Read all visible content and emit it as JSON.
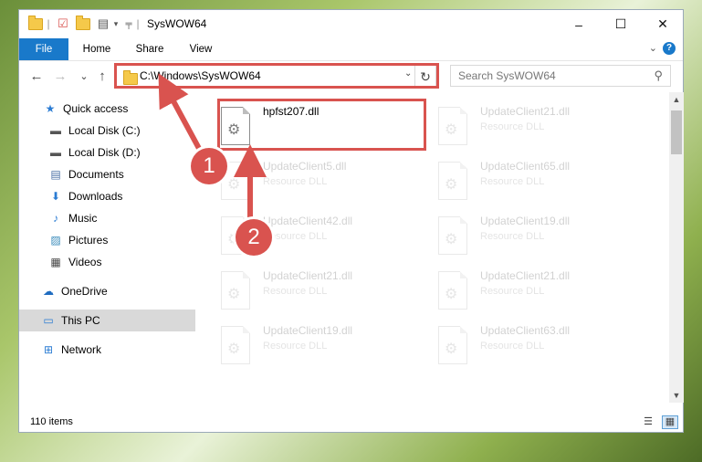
{
  "window": {
    "title": "SysWOW64",
    "controls": {
      "minimize": "–",
      "maximize": "☐",
      "close": "✕"
    }
  },
  "ribbon": {
    "tabs": [
      {
        "label": "File"
      },
      {
        "label": "Home"
      },
      {
        "label": "Share"
      },
      {
        "label": "View"
      }
    ],
    "expand": "⌄",
    "help": "?"
  },
  "navbar": {
    "back": "←",
    "forward": "→",
    "recent": "⌄",
    "up": "↑",
    "address": "C:\\Windows\\SysWOW64",
    "address_dropdown": "⌄",
    "refresh": "↻",
    "search_placeholder": "Search SysWOW64",
    "search_icon": "⚲"
  },
  "sidebar": {
    "items": [
      {
        "label": "Quick access",
        "icon": "star-icon",
        "glyph": "★",
        "color": "#2b7cd3",
        "pinned": false
      },
      {
        "label": "Local Disk (C:)",
        "icon": "drive-icon",
        "glyph": "▬",
        "color": "#555555",
        "pinned": true
      },
      {
        "label": "Local Disk (D:)",
        "icon": "drive-icon",
        "glyph": "▬",
        "color": "#555555",
        "pinned": true
      },
      {
        "label": "Documents",
        "icon": "documents-icon",
        "glyph": "▤",
        "color": "#4a6fa5",
        "pinned": true
      },
      {
        "label": "Downloads",
        "icon": "downloads-icon",
        "glyph": "⬇",
        "color": "#2b7cd3",
        "pinned": true
      },
      {
        "label": "Music",
        "icon": "music-icon",
        "glyph": "♪",
        "color": "#2b7cd3",
        "pinned": true
      },
      {
        "label": "Pictures",
        "icon": "pictures-icon",
        "glyph": "▨",
        "color": "#3c8dbc",
        "pinned": true
      },
      {
        "label": "Videos",
        "icon": "videos-icon",
        "glyph": "▦",
        "color": "#444444",
        "pinned": true
      },
      {
        "label": "OneDrive",
        "icon": "onedrive-icon",
        "glyph": "☁",
        "color": "#1f6cc0",
        "pinned": false
      },
      {
        "label": "This PC",
        "icon": "computer-icon",
        "glyph": "▭",
        "color": "#2b7cd3",
        "pinned": false,
        "selected": true
      },
      {
        "label": "Network",
        "icon": "network-icon",
        "glyph": "⊞",
        "color": "#2b7cd3",
        "pinned": false
      }
    ],
    "pin_glyph": "📌"
  },
  "files": [
    {
      "name": "hpfst207.dll",
      "type": "",
      "faded": false
    },
    {
      "name": "UpdateClient21.dll",
      "type": "Resource DLL",
      "faded": true
    },
    {
      "name": "UpdateClient5.dll",
      "type": "Resource DLL",
      "faded": true
    },
    {
      "name": "UpdateClient65.dll",
      "type": "Resource DLL",
      "faded": true
    },
    {
      "name": "UpdateClient42.dll",
      "type": "Resource DLL",
      "faded": true
    },
    {
      "name": "UpdateClient19.dll",
      "type": "Resource DLL",
      "faded": true
    },
    {
      "name": "UpdateClient21.dll",
      "type": "Resource DLL",
      "faded": true
    },
    {
      "name": "UpdateClient21.dll",
      "type": "Resource DLL",
      "faded": true
    },
    {
      "name": "UpdateClient19.dll",
      "type": "Resource DLL",
      "faded": true
    },
    {
      "name": "UpdateClient63.dll",
      "type": "Resource DLL",
      "faded": true
    }
  ],
  "status": {
    "item_count": "110 items",
    "details_view": "☰",
    "tiles_view": "▦"
  },
  "annotations": {
    "badge_1": "1",
    "badge_2": "2",
    "accent_color": "#d9534f"
  },
  "scrollbar": {
    "up": "▲",
    "down": "▼"
  }
}
